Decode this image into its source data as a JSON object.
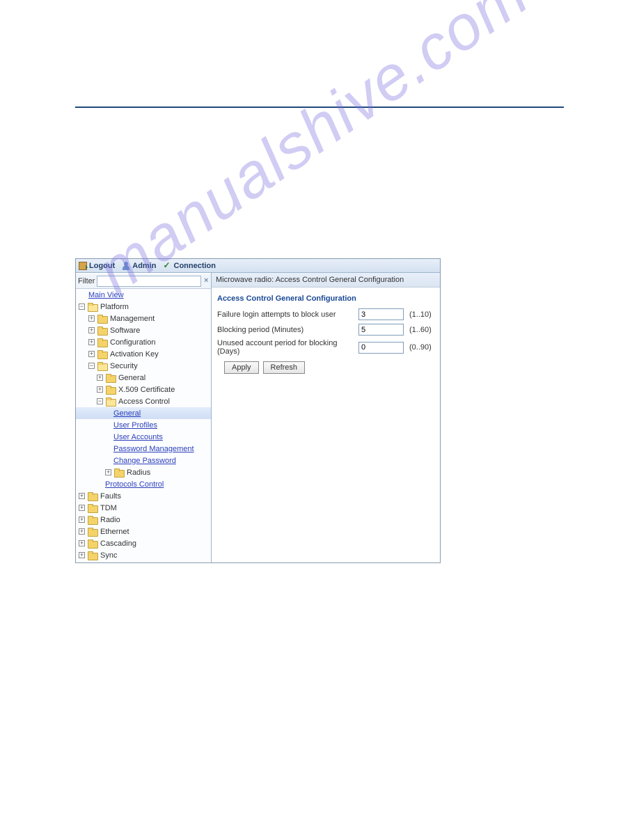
{
  "watermark": "manualshive.com",
  "toolbar": {
    "logout": "Logout",
    "admin": "Admin",
    "connection": "Connection"
  },
  "filter": {
    "label": "Filter",
    "value": "",
    "clear_glyph": "×"
  },
  "tree": {
    "main_view": "Main View",
    "platform": "Platform",
    "management": "Management",
    "software": "Software",
    "configuration": "Configuration",
    "activation_key": "Activation Key",
    "security": "Security",
    "general": "General",
    "x509": "X.509 Certificate",
    "access_control": "Access Control",
    "ac_general": "General",
    "ac_user_profiles": "User Profiles",
    "ac_user_accounts": "User Accounts",
    "ac_password_mgmt": "Password Management",
    "ac_change_password": "Change Password",
    "ac_radius": "Radius",
    "protocols_control": "Protocols Control",
    "faults": "Faults",
    "tdm": "TDM",
    "radio": "Radio",
    "ethernet": "Ethernet",
    "cascading": "Cascading",
    "sync": "Sync"
  },
  "content": {
    "breadcrumb": "Microwave radio: Access Control General Configuration",
    "section_title": "Access Control General Configuration",
    "rows": {
      "failure_attempts": {
        "label": "Failure login attempts to block user",
        "value": "3",
        "hint": "(1..10)"
      },
      "blocking_period": {
        "label": "Blocking period (Minutes)",
        "value": "5",
        "hint": "(1..60)"
      },
      "unused_period": {
        "label": "Unused account period for blocking (Days)",
        "value": "0",
        "hint": "(0..90)"
      }
    },
    "buttons": {
      "apply": "Apply",
      "refresh": "Refresh"
    }
  }
}
